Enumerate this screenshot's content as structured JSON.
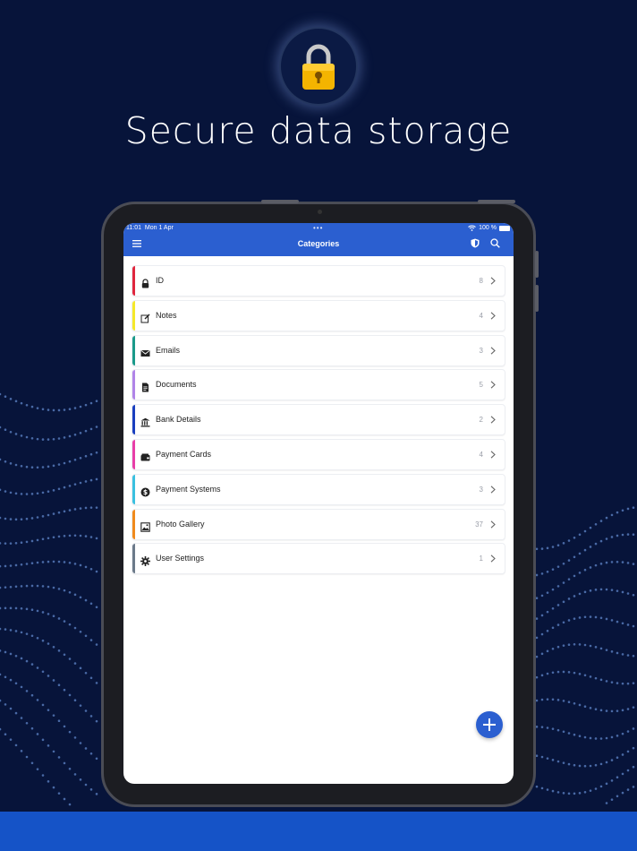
{
  "headline": "Secure data storage",
  "device": {
    "status_time": "11:01",
    "status_date": "Mon 1 Apr",
    "status_battery": "100 %",
    "multitask_dots": "•••"
  },
  "appbar": {
    "title": "Categories",
    "menu_icon": "hamburger-menu-icon",
    "shield_icon": "shield-icon",
    "search_icon": "search-icon"
  },
  "categories": [
    {
      "label": "ID",
      "count": "8",
      "color": "#e0273e",
      "icon": "lock-icon"
    },
    {
      "label": "Notes",
      "count": "4",
      "color": "#f5e82a",
      "icon": "edit-note-icon"
    },
    {
      "label": "Emails",
      "count": "3",
      "color": "#1a9a8a",
      "icon": "envelope-icon"
    },
    {
      "label": "Documents",
      "count": "5",
      "color": "#b084e8",
      "icon": "document-icon"
    },
    {
      "label": "Bank Details",
      "count": "2",
      "color": "#1a3fbf",
      "icon": "bank-icon"
    },
    {
      "label": "Payment Cards",
      "count": "4",
      "color": "#e83ea8",
      "icon": "wallet-icon"
    },
    {
      "label": "Payment Systems",
      "count": "3",
      "color": "#3ac0e0",
      "icon": "dollar-coin-icon"
    },
    {
      "label": "Photo Gallery",
      "count": "37",
      "color": "#f08a1c",
      "icon": "image-icon"
    },
    {
      "label": "User Settings",
      "count": "1",
      "color": "#6c7a8a",
      "icon": "gear-icon"
    }
  ],
  "fab": {
    "icon": "plus-icon"
  },
  "colors": {
    "background": "#07143a",
    "accent": "#2b5fd0",
    "band": "#1553c7"
  }
}
